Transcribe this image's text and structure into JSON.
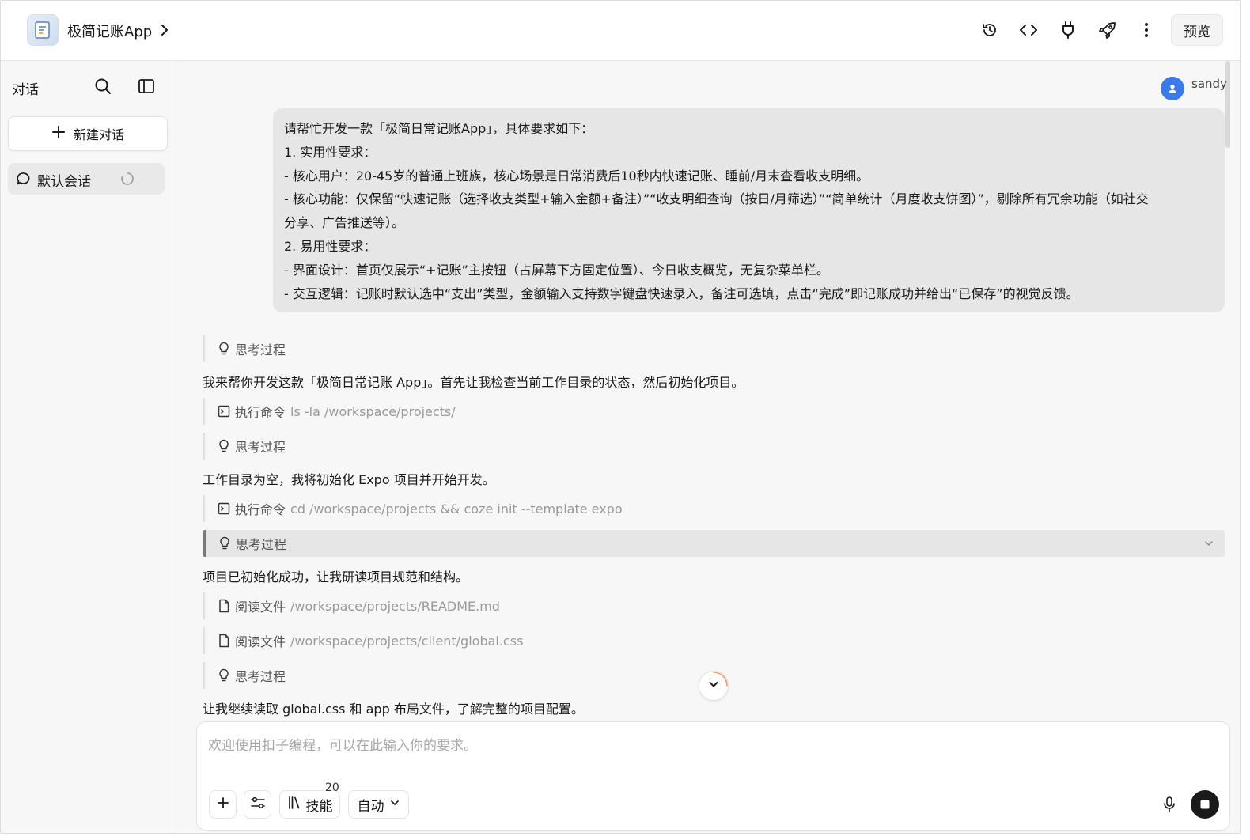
{
  "header": {
    "app_title": "极简记账App",
    "preview_label": "预览",
    "icons": [
      "history-icon",
      "code-icon",
      "plug-icon",
      "rocket-icon",
      "more-icon"
    ]
  },
  "sidebar": {
    "title": "对话",
    "new_chat_label": "新建对话",
    "sessions": [
      {
        "label": "默认会话",
        "loading": true
      }
    ]
  },
  "chat": {
    "username": "sandy",
    "user_message_lines": [
      "请帮忙开发一款「极简日常记账App」，具体要求如下：",
      "1. 实用性要求：",
      "- 核心用户：20-45岁的普通上班族，核心场景是日常消费后10秒内快速记账、睡前/月末查看收支明细。",
      "- 核心功能：仅保留“快速记账（选择收支类型+输入金额+备注）”“收支明细查询（按日/月筛选）”“简单统计（月度收支饼图）”，剔除所有冗余功能（如社交",
      "分享、广告推送等）。",
      "2. 易用性要求：",
      "- 界面设计：首页仅展示“+记账”主按钮（占屏幕下方固定位置）、今日收支概览，无复杂菜单栏。",
      "- 交互逻辑：记账时默认选中“支出”类型，金额输入支持数字键盘快速录入，备注可选填，点击“完成”即记账成功并给出“已保存”的视觉反馈。"
    ],
    "thinking_label": "思考过程",
    "exec_label": "执行命令",
    "read_label": "阅读文件",
    "assistant_msg_1": "我来帮你开发这款「极简日常记账 App」。首先让我检查当前工作目录的状态，然后初始化项目。",
    "cmd_1": "ls -la /workspace/projects/",
    "assistant_msg_2": "工作目录为空，我将初始化 Expo 项目并开始开发。",
    "cmd_2": "cd /workspace/projects && coze init --template expo",
    "assistant_msg_3": "项目已初始化成功，让我研读项目规范和结构。",
    "file_1": "/workspace/projects/README.md",
    "file_2": "/workspace/projects/client/global.css",
    "assistant_msg_4": "让我继续读取 global.css 和 app 布局文件，了解完整的项目配置。"
  },
  "composer": {
    "placeholder": "欢迎使用扣子编程，可以在此输入你的要求。",
    "skills_label": "技能",
    "skills_count": "20",
    "mode_label": "自动"
  },
  "colors": {
    "accent": "#3a7be8",
    "stop": "#1a1a1a"
  }
}
